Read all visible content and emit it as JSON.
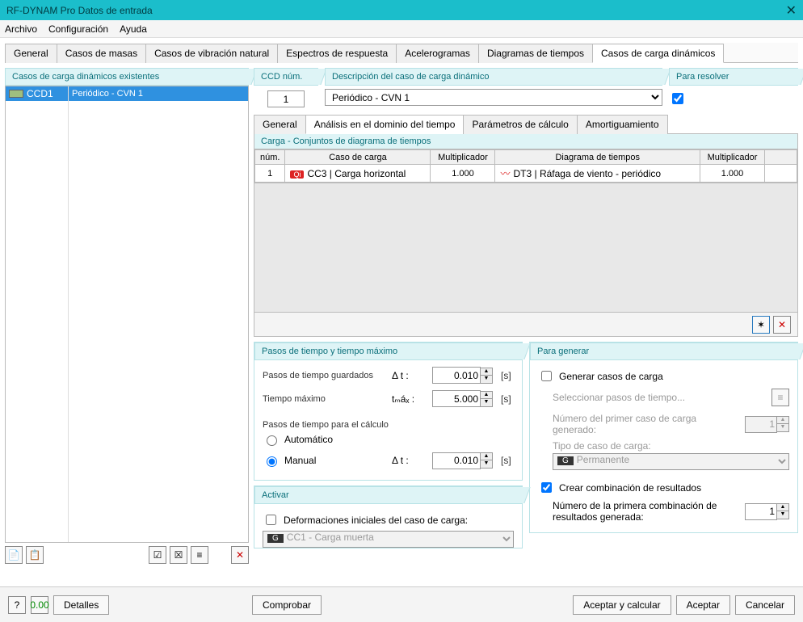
{
  "window": {
    "title": "RF-DYNAM Pro Datos de entrada",
    "close": "✕"
  },
  "menu": {
    "file": "Archivo",
    "config": "Configuración",
    "help": "Ayuda"
  },
  "mainTabs": {
    "general": "General",
    "masas": "Casos de masas",
    "vibracion": "Casos de vibración natural",
    "espectros": "Espectros de respuesta",
    "acelero": "Acelerogramas",
    "diagramas": "Diagramas de tiempos",
    "dinamicos": "Casos de carga dinámicos"
  },
  "leftPanel": {
    "header": "Casos de carga dinámicos existentes",
    "row": {
      "code": "CCD1",
      "name": "Periódico - CVN 1"
    }
  },
  "ccd": {
    "label": "CCD núm.",
    "value": "1"
  },
  "desc": {
    "label": "Descripción del caso de carga dinámico",
    "value": "Periódico - CVN 1"
  },
  "solve": {
    "label": "Para resolver"
  },
  "subTabs": {
    "general": "General",
    "analisis": "Análisis en el dominio del tiempo",
    "params": "Parámetros de cálculo",
    "amort": "Amortiguamiento"
  },
  "grid": {
    "title": "Carga - Conjuntos de diagrama de tiempos",
    "h_num": "núm.",
    "h_caso": "Caso de carga",
    "h_mult1": "Multiplicador",
    "h_diag": "Diagrama de tiempos",
    "h_mult2": "Multiplicador",
    "row": {
      "num": "1",
      "caso_badge": "Qi",
      "caso": "CC3 | Carga horizontal",
      "mult1": "1.000",
      "diag": "DT3 | Ráfaga de viento - periódico",
      "mult2": "1.000"
    }
  },
  "steps": {
    "header": "Pasos de tiempo y tiempo máximo",
    "saved": "Pasos de tiempo guardados",
    "dt": "Δ t :",
    "dt_val": "0.010",
    "unit": "[s]",
    "tmax": "Tiempo máximo",
    "tmax_sym": "tₘáₓ :",
    "tmax_val": "5.000",
    "calc": "Pasos de tiempo para el cálculo",
    "auto": "Automático",
    "manual": "Manual",
    "dt2_val": "0.010"
  },
  "activate": {
    "header": "Activar",
    "deform": "Deformaciones iniciales del caso de carga:",
    "case_badge": "G",
    "case": "CC1 - Carga muerta"
  },
  "generate": {
    "header": "Para generar",
    "gen_cases": "Generar casos de carga",
    "select_steps": "Seleccionar pasos de tiempo...",
    "num_first": "Número del primer caso de carga generado:",
    "num_first_val": "1",
    "tipo": "Tipo de caso de carga:",
    "tipo_badge": "G",
    "tipo_val": "Permanente",
    "crear": "Crear combinación de resultados",
    "num_comb": "Número de la primera combinación de resultados generada:",
    "num_comb_val": "1"
  },
  "footer": {
    "details": "Detalles",
    "check": "Comprobar",
    "accept_calc": "Aceptar y calcular",
    "accept": "Aceptar",
    "cancel": "Cancelar"
  }
}
